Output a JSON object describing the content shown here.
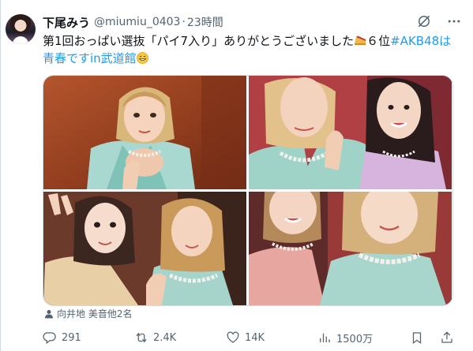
{
  "tweet": {
    "author_name": "下尾みう",
    "handle": "@miumiu_0403",
    "separator": "·",
    "time": "23時間",
    "text_part1": "第1回おっぱい選抜「パイ7入り」ありがとうございました",
    "text_part2": "６位",
    "hashtag": "#AKB48は青春ですin武道館",
    "tagged_users": "向井地 美音他2名"
  },
  "actions": {
    "replies": "291",
    "reposts": "2.4K",
    "likes": "14K",
    "views": "1500万"
  },
  "icons": [
    "grok-icon",
    "more-icon",
    "reply-icon",
    "repost-icon",
    "like-icon",
    "views-icon",
    "bookmark-icon",
    "share-icon",
    "pie-emoji",
    "grin-emoji",
    "person-icon"
  ],
  "colors": {
    "link": "#1d9bf0",
    "secondary": "#536471",
    "text": "#0f1419"
  }
}
